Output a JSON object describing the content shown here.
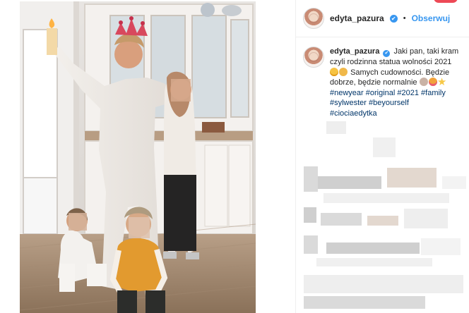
{
  "post": {
    "username": "edyta_pazura",
    "verified_mark": "✔",
    "separator": "•",
    "follow_label": "Obserwuj"
  },
  "caption": {
    "username": "edyta_pazura",
    "text_line1": "Jaki pan, taki kram",
    "text_line2": "czyli rodzinna statua wolności 2021",
    "text_line3": "Samych cudowności. Będzie",
    "text_line4": "dobrze, będzie normalnie",
    "hashtags_line1": "#newyear #original #2021 #family",
    "hashtags_line2": "#sylwester #beyourself",
    "hashtags_line3": "#ciociaedytka"
  },
  "colors": {
    "accent": "#3897f0",
    "text": "#262626",
    "hashtag": "#003569",
    "notification": "#ed4956"
  },
  "icons": {
    "avatar": "profile-avatar",
    "verified": "verified-badge-icon",
    "emoji_1": "smiling-face-emoji",
    "emoji_2": "hugging-face-emoji",
    "emoji_3": "folded-hands-emoji",
    "emoji_4": "smiling-hearts-face-emoji",
    "emoji_5": "sparkles-emoji"
  }
}
